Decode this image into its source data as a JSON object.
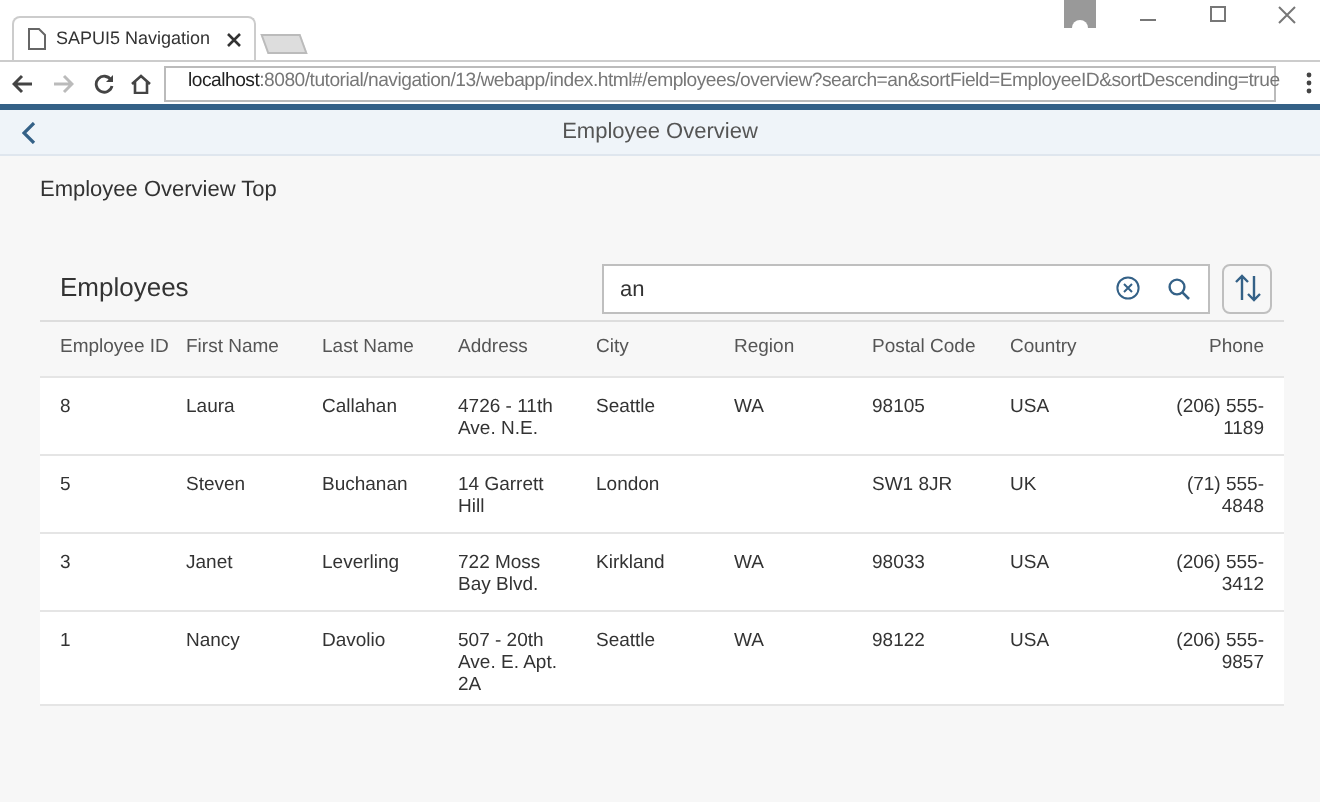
{
  "browser": {
    "tab_title": "SAPUI5 Navigation",
    "url": "**localhost**:8080/tutorial/navigation/13/webapp/index.html#/employees/overview?search=an&sortField=EmployeeID&sortDescending=true"
  },
  "page": {
    "title": "Employee Overview",
    "subheader": "Employee Overview Top"
  },
  "table": {
    "title": "Employees",
    "search": {
      "value": "an"
    },
    "columns": [
      "Employee ID",
      "First Name",
      "Last Name",
      "Address",
      "City",
      "Region",
      "Postal Code",
      "Country",
      "Phone"
    ],
    "rows": [
      {
        "cells": [
          "8",
          "Laura",
          "Callahan",
          "4726 - 11th Ave. N.E.",
          "Seattle",
          "WA",
          "98105",
          "USA",
          "(206) 555-1189"
        ]
      },
      {
        "cells": [
          "5",
          "Steven",
          "Buchanan",
          "14 Garrett Hill",
          "London",
          "",
          "SW1 8JR",
          "UK",
          "(71) 555-4848"
        ]
      },
      {
        "cells": [
          "3",
          "Janet",
          "Leverling",
          "722 Moss Bay Blvd.",
          "Kirkland",
          "WA",
          "98033",
          "USA",
          "(206) 555-3412"
        ]
      },
      {
        "cells": [
          "1",
          "Nancy",
          "Davolio",
          "507 - 20th Ave. E. Apt. 2A",
          "Seattle",
          "WA",
          "98122",
          "USA",
          "(206) 555-9857"
        ]
      }
    ]
  }
}
